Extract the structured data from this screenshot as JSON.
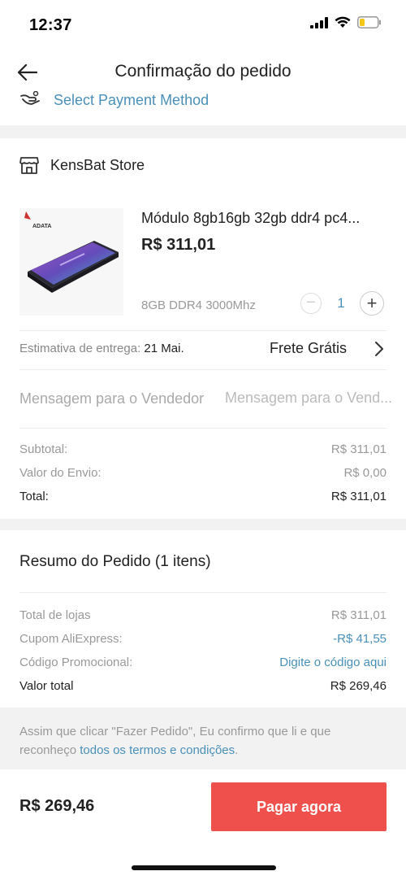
{
  "status_bar": {
    "time": "12:37"
  },
  "nav": {
    "title": "Confirmação do pedido",
    "back_icon": "arrow-left-icon"
  },
  "payment": {
    "label": "Select Payment Method",
    "icon": "hand-coin-icon"
  },
  "store": {
    "icon": "storefront-icon",
    "name": "KensBat Store",
    "product": {
      "brand_logo": "ADATA",
      "title": "Módulo 8gb16gb 32gb ddr4 pc4...",
      "price": "R$ 311,01",
      "variant": "8GB DDR4 3000Mhz",
      "quantity": "1"
    },
    "delivery": {
      "label": "Estimativa de entrega:",
      "date": "21 Mai.",
      "shipping": "Frete Grátis"
    },
    "message": {
      "label": "Mensagem para o Vendedor",
      "placeholder": "Mensagem para o Vend..."
    },
    "totals": {
      "subtotal_label": "Subtotal:",
      "subtotal_value": "R$ 311,01",
      "shipping_label": "Valor do Envio:",
      "shipping_value": "R$ 0,00",
      "total_label": "Total:",
      "total_value": "R$ 311,01"
    }
  },
  "summary": {
    "title": "Resumo do Pedido (1 itens)",
    "rows": {
      "stores_label": "Total de lojas",
      "stores_value": "R$ 311,01",
      "coupon_label": "Cupom AliExpress:",
      "coupon_value": "-R$ 41,55",
      "promo_label": "Código Promocional:",
      "promo_value": "Digite o código aqui",
      "grand_label": "Valor total",
      "grand_value": "R$ 269,46"
    }
  },
  "terms": {
    "text": "Assim que clicar \"Fazer Pedido\", Eu confirmo que li e que reconheço ",
    "link": "todos os termos e condições",
    "suffix": "."
  },
  "footer": {
    "total": "R$ 269,46",
    "pay_label": "Pagar agora"
  },
  "colors": {
    "accent_blue": "#4a90b8",
    "pay_button": "#f0504c",
    "section_gap": "#f2f2f2"
  }
}
